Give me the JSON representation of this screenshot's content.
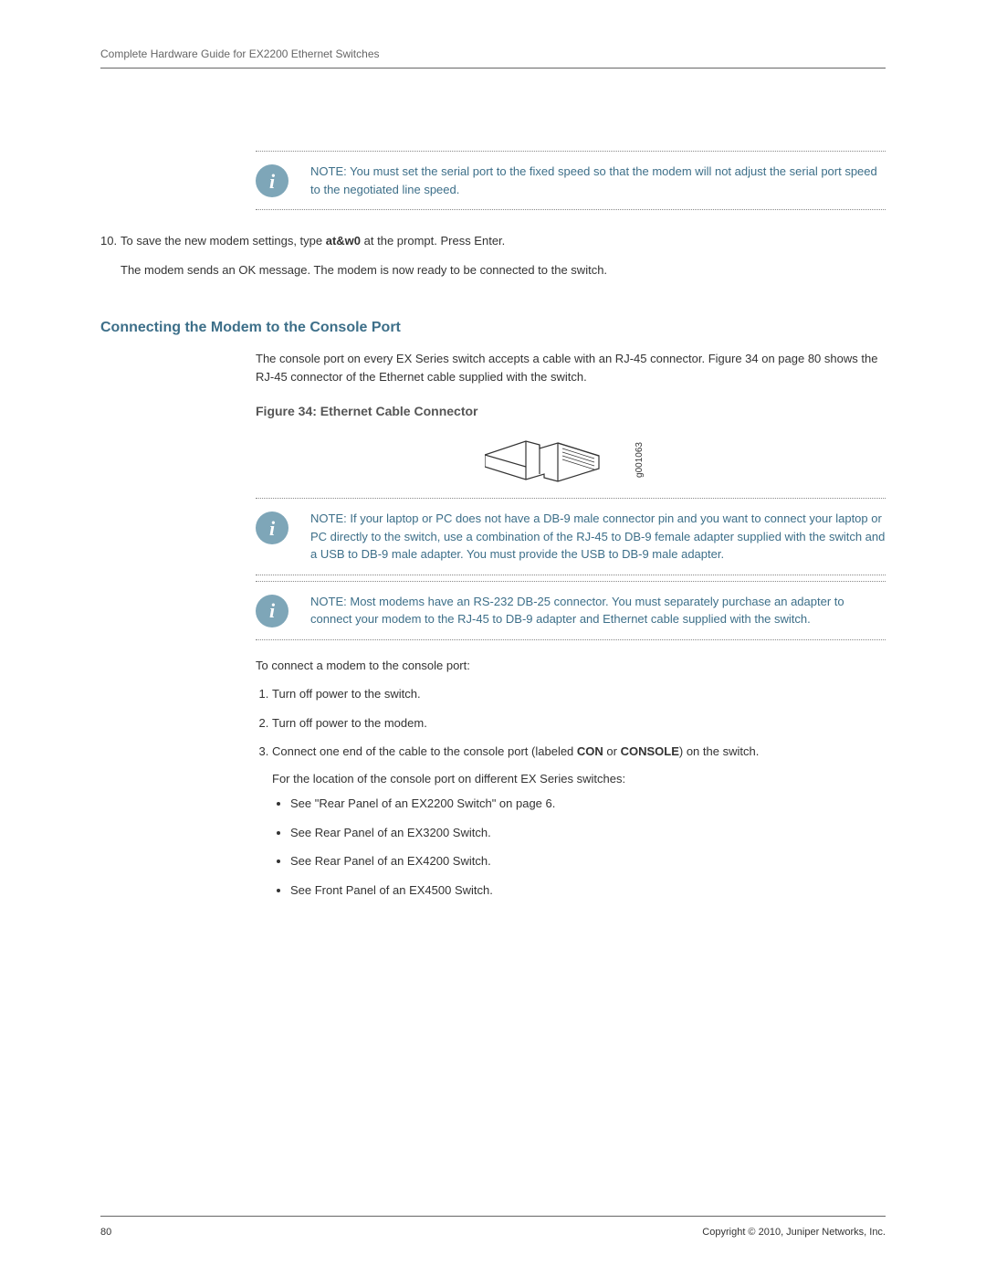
{
  "header": {
    "title": "Complete Hardware Guide for EX2200 Ethernet Switches"
  },
  "body": {
    "note1_label": "NOTE:",
    "note1_text": "You must set the serial port to the fixed speed so that the modem will not adjust the serial port speed to the negotiated line speed.",
    "step10": {
      "num": "10.",
      "text_a": "To save the new modem settings, type ",
      "text_cmd": "at&w0",
      "text_b": " at the prompt. Press Enter.",
      "text_c": "The modem sends an OK message. The modem is now ready to be connected to the switch."
    },
    "section_heading": "Connecting the Modem to the Console Port",
    "intro": "The console port on every EX Series switch accepts a cable with an RJ-45 connector. Figure 34 on page 80 shows the RJ-45 connector of the Ethernet cable supplied with the switch.",
    "figure_caption": "Figure 34: Ethernet Cable Connector",
    "figure_id": "g001063",
    "note2_label": "NOTE:",
    "note2_text": "If your laptop or PC does not have a DB-9 male connector pin and you want to connect your laptop or PC directly to the switch, use a combination of the RJ-45 to DB-9 female adapter supplied with the switch and a USB to DB-9 male adapter. You must provide the USB to DB-9 male adapter.",
    "note3_label": "NOTE:",
    "note3_text": "Most modems have an RS-232 DB-25 connector. You must separately purchase an adapter to connect your modem to the RJ-45 to DB-9 adapter and Ethernet cable supplied with the switch.",
    "steps_intro": "To connect a modem to the console port:",
    "steps": {
      "s1": "Turn off power to the switch.",
      "s2": "Turn off power to the modem.",
      "s3_a": "Connect one end of the cable to the console port (labeled ",
      "s3_b1": "CON",
      "s3_mid": " or ",
      "s3_b2": "CONSOLE",
      "s3_c": ") on the switch.",
      "s3_sub": "For the location of the console port on different EX Series switches:",
      "bul1": "See \"Rear Panel of an EX2200 Switch\" on page 6.",
      "bul2": "See Rear Panel of an EX3200 Switch.",
      "bul3": "See Rear Panel of an EX4200 Switch.",
      "bul4": "See Front Panel of an EX4500 Switch."
    }
  },
  "footer": {
    "page_number": "80",
    "copyright": "Copyright © 2010, Juniper Networks, Inc."
  }
}
